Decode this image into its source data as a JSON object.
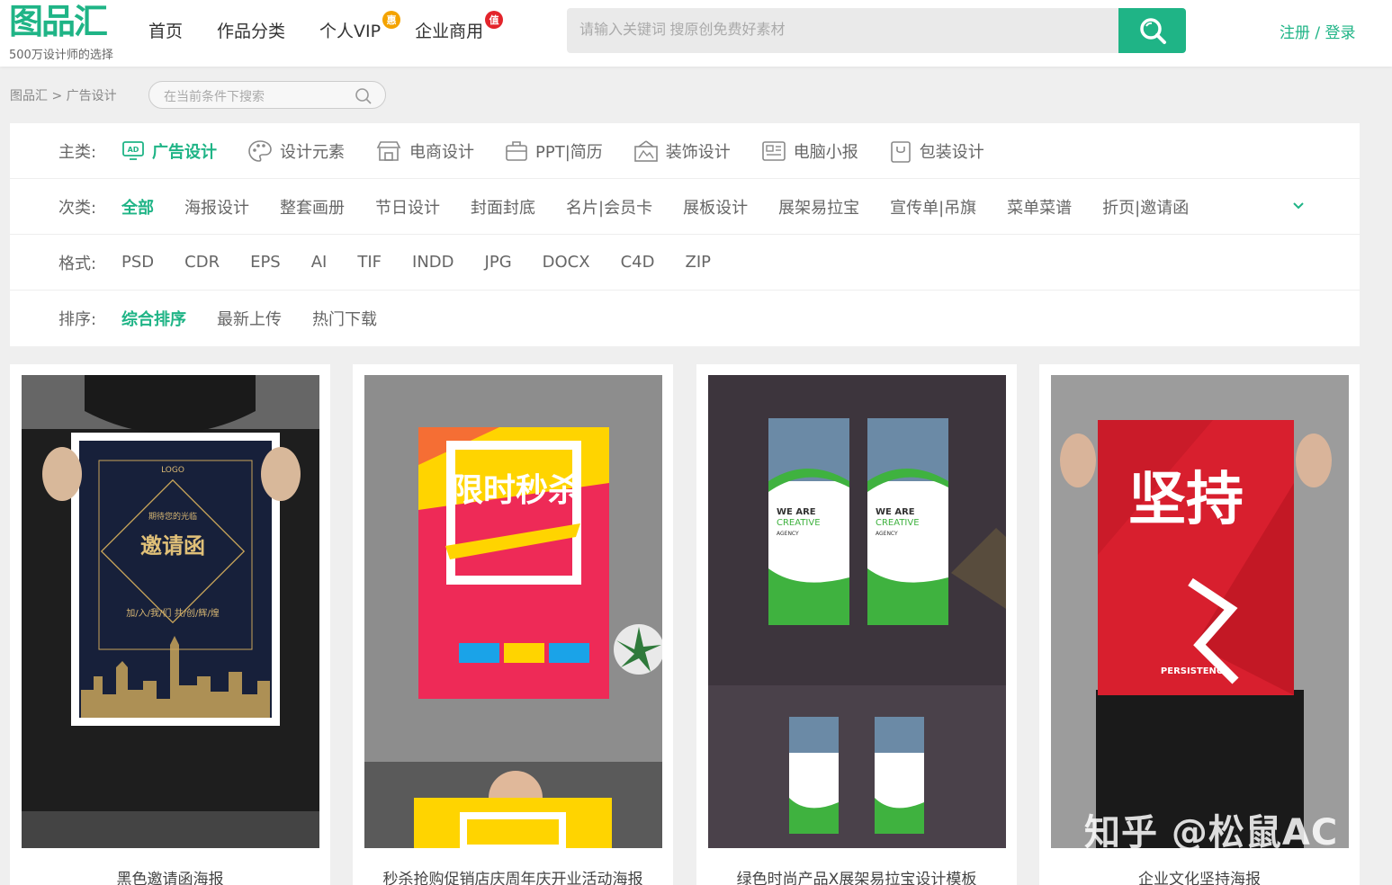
{
  "brand": {
    "logo_text": "图品汇",
    "tagline": "500万设计师的选择"
  },
  "nav": {
    "items": [
      {
        "label": "首页"
      },
      {
        "label": "作品分类"
      },
      {
        "label": "个人VIP",
        "badge": "惠"
      },
      {
        "label": "企业商用",
        "badge": "值"
      }
    ]
  },
  "search": {
    "placeholder": "请输入关键词 搜原创免费好素材"
  },
  "auth": {
    "label": "注册 / 登录"
  },
  "breadcrumb": "图品汇 > 广告设计",
  "filter_search": {
    "placeholder": "在当前条件下搜索"
  },
  "filters": {
    "main": {
      "label": "主类:",
      "options": [
        {
          "label": "广告设计",
          "icon": "ad-icon"
        },
        {
          "label": "设计元素",
          "icon": "palette-icon"
        },
        {
          "label": "电商设计",
          "icon": "shop-icon"
        },
        {
          "label": "PPT|简历",
          "icon": "briefcase-icon"
        },
        {
          "label": "装饰设计",
          "icon": "frame-icon"
        },
        {
          "label": "电脑小报",
          "icon": "newspaper-icon"
        },
        {
          "label": "包装设计",
          "icon": "bag-icon"
        }
      ]
    },
    "sub": {
      "label": "次类:",
      "options": [
        "全部",
        "海报设计",
        "整套画册",
        "节日设计",
        "封面封底",
        "名片|会员卡",
        "展板设计",
        "展架易拉宝",
        "宣传单|吊旗",
        "菜单菜谱",
        "折页|邀请函"
      ]
    },
    "format": {
      "label": "格式:",
      "options": [
        "PSD",
        "CDR",
        "EPS",
        "AI",
        "TIF",
        "INDD",
        "JPG",
        "DOCX",
        "C4D",
        "ZIP"
      ]
    },
    "sort": {
      "label": "排序:",
      "options": [
        "综合排序",
        "最新上传",
        "热门下载"
      ]
    }
  },
  "cards": [
    {
      "title": "黑色邀请函海报",
      "poster": {
        "logo": "LOGO",
        "line": "期待您的光临",
        "main": "邀请函",
        "bottom": "加/入/我/们 共/创/辉/煌"
      }
    },
    {
      "title": "秒杀抢购促销店庆周年庆开业活动海报",
      "poster": {
        "main": "限时秒杀"
      }
    },
    {
      "title": "绿色时尚产品X展架易拉宝设计模板",
      "poster": {
        "main": "WE ARE",
        "sub": "CREATIVE",
        "tag": "AGENCY"
      }
    },
    {
      "title": "企业文化坚持海报",
      "poster": {
        "main": "坚持",
        "sub": "PERSISTENCE"
      }
    }
  ],
  "watermark": "知乎 @松鼠AC",
  "colors": {
    "accent": "#1fb486",
    "badge_orange": "#f4a300",
    "badge_red": "#e3242b"
  }
}
